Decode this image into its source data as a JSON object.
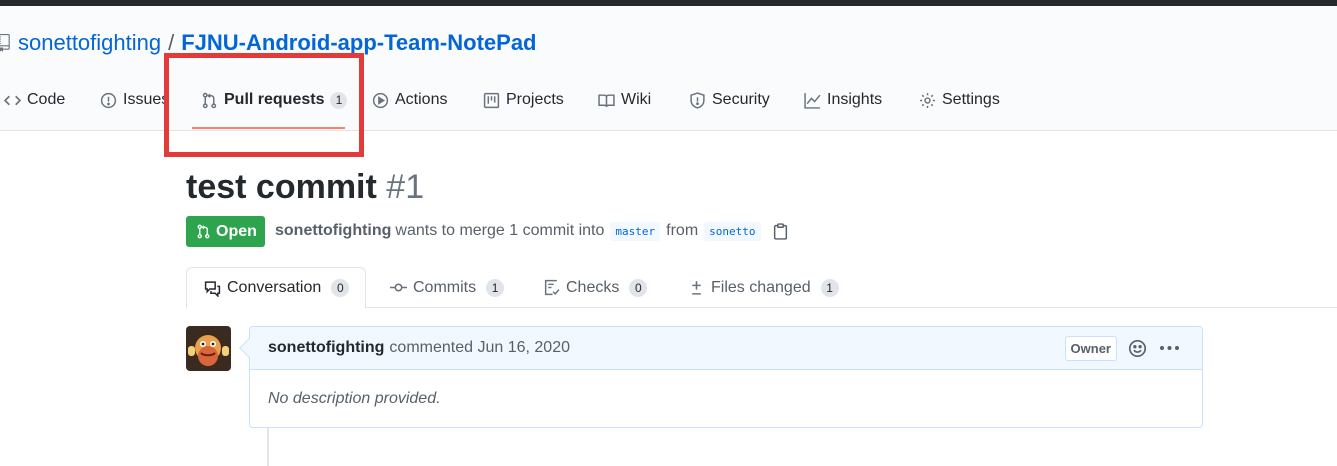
{
  "repo": {
    "owner": "sonettofighting",
    "separator": "/",
    "name": "FJNU-Android-app-Team-NotePad"
  },
  "nav": {
    "code": "Code",
    "issues": "Issues",
    "pull_requests": "Pull requests",
    "pull_requests_count": "1",
    "actions": "Actions",
    "projects": "Projects",
    "wiki": "Wiki",
    "security": "Security",
    "insights": "Insights",
    "settings": "Settings"
  },
  "pr": {
    "title": "test commit",
    "number": "#1",
    "state": "Open",
    "author": "sonettofighting",
    "merge_text": "wants to merge 1 commit into",
    "base_branch": "master",
    "from_text": "from",
    "head_branch": "sonetto"
  },
  "tabs": {
    "conversation": "Conversation",
    "conversation_count": "0",
    "commits": "Commits",
    "commits_count": "1",
    "checks": "Checks",
    "checks_count": "0",
    "files_changed": "Files changed",
    "files_changed_count": "1"
  },
  "comment": {
    "author": "sonettofighting",
    "action": "commented Jun 16, 2020",
    "badge": "Owner",
    "body": "No description provided."
  },
  "colors": {
    "accent_link": "#0366d6",
    "open_green": "#2ea44f",
    "nav_underline": "#f9826c",
    "highlight_box": "#e33a3a"
  }
}
